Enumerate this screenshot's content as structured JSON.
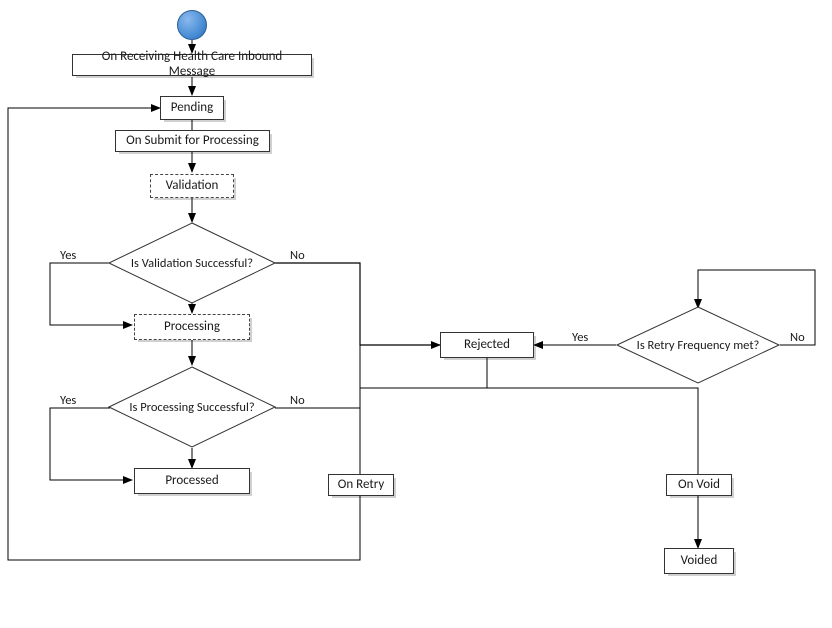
{
  "diagram": {
    "start_label": "On Receiving Health Care Inbound Message",
    "states": {
      "pending": "Pending",
      "validation": "Validation",
      "processing": "Processing",
      "rejected": "Rejected",
      "processed": "Processed",
      "voided": "Voided"
    },
    "decisions": {
      "validation_ok": "Is Validation Successful?",
      "processing_ok": "Is Processing Successful?",
      "retry_freq": "Is Retry Frequency met?"
    },
    "edges": {
      "submit": "On Submit for Processing",
      "yes": "Yes",
      "no": "No",
      "on_retry": "On Retry",
      "on_void": "On Void"
    }
  }
}
